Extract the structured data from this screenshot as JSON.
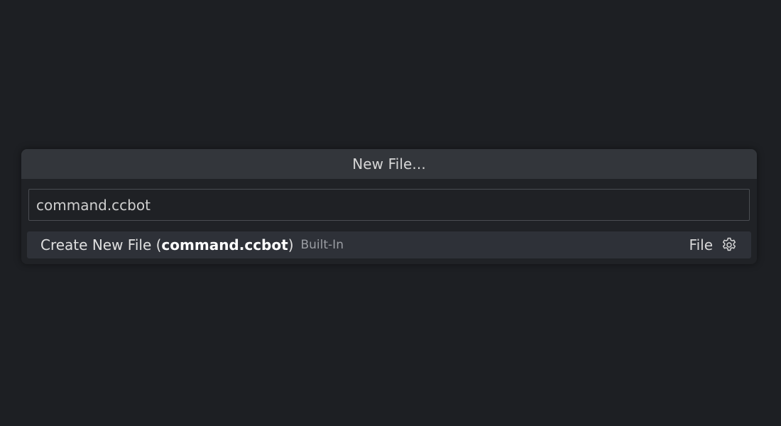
{
  "quick_pick": {
    "title": "New File...",
    "input": {
      "value": "command.ccbot",
      "placeholder": ""
    },
    "items": [
      {
        "label_prefix": "Create New File (",
        "label_highlight": "command.ccbot",
        "label_suffix": ")",
        "description": "Built-In",
        "detail": "File",
        "action_icon": "gear-icon"
      }
    ]
  },
  "colors": {
    "background": "#1d1f23",
    "title_bar": "#33363b",
    "selected_row": "#2e3138",
    "input_border": "#4a4d52"
  }
}
